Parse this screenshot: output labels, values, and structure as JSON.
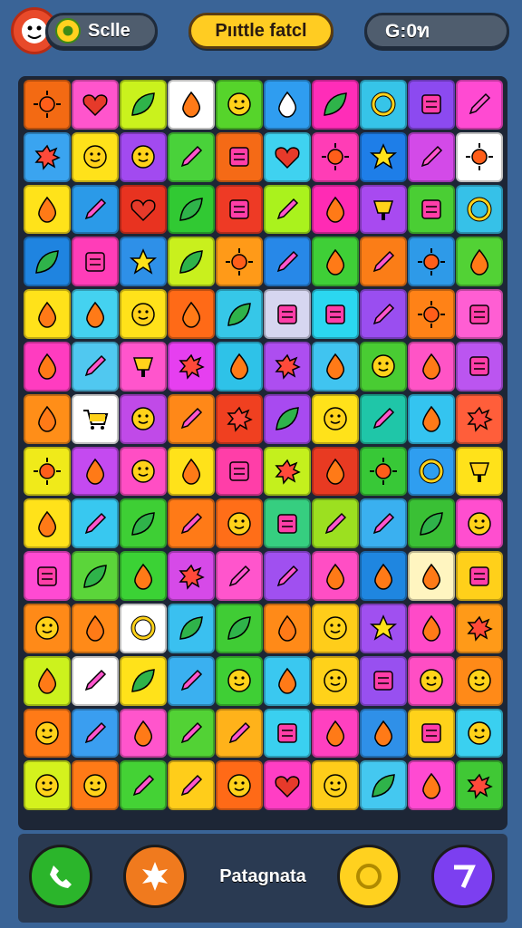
{
  "header": {
    "left_label": "Sclle",
    "title": "Pııttle fatcl",
    "right_value": "G:0ท"
  },
  "footer": {
    "label": "Patagnata",
    "buttons": [
      {
        "name": "phone-button",
        "icon": "phone-icon",
        "color": "#2bb52b"
      },
      {
        "name": "burst-button",
        "icon": "burst-icon",
        "color": "#f07a1e"
      },
      {
        "name": "coin-button",
        "icon": "coin-icon",
        "color": "#ffd11f"
      },
      {
        "name": "seven-button",
        "icon": "seven-icon",
        "color": "#7c3ff0"
      }
    ]
  },
  "board": {
    "rows": 14,
    "cols": 10,
    "tiles": [
      [
        "#f36a13:sun",
        "#ff55cc:heart",
        "#caf21d:leaf",
        "#ffffff:drop",
        "#56d42b:face",
        "#2f9df0:bell",
        "#ff2db8:leaf",
        "#36c4e8:ring",
        "#8c4af0:box",
        "#ff4ad2:pencil"
      ],
      [
        "#3aa4f0:splat",
        "#ffe21a:face",
        "#a24af0:face",
        "#49d23a:pencil",
        "#f56a16:box",
        "#3fd2f0:heart",
        "#ff3db6:sun",
        "#1e7ee8:star",
        "#d34ae8:pencil",
        "#ffffff:sun"
      ],
      [
        "#ffe31a:drop",
        "#2b9ae8:pencil",
        "#e83320:heart",
        "#31c933:leaf",
        "#ee3a25:box",
        "#aaf21d:pencil",
        "#ff2bb4:drop",
        "#a84af0:cup",
        "#4ace34:box",
        "#36c1e8:ring"
      ],
      [
        "#1f84e0:leaf",
        "#ff3db8:box",
        "#2e90e8:star",
        "#c9f01d:leaf",
        "#ff9a18:sun",
        "#2788e8:pencil",
        "#3fcf37:drop",
        "#fb7d17:pencil",
        "#2e9ae8:sun",
        "#52d235:drop"
      ],
      [
        "#ffe21a:drop",
        "#44d2f0:drop",
        "#ffe21a:face",
        "#ff6a17:drop",
        "#36c7e8:leaf",
        "#d6d6f0:box",
        "#2bd7f0:box",
        "#9a4ef0:pencil",
        "#ff8217:sun",
        "#ff5ed3:box"
      ],
      [
        "#ff3cc0:drop",
        "#50c8f0:pencil",
        "#ff55cc:cup",
        "#e63ff0:splat",
        "#2ec2e8:drop",
        "#ad4ef0:splat",
        "#40c4f0:drop",
        "#49cc33:face",
        "#ff54c6:drop",
        "#bb55f0:box"
      ],
      [
        "#ff8e18:drop",
        "#ffffff:cart",
        "#c04ae8:face",
        "#ff8818:pencil",
        "#f04020:splat",
        "#a84af0:leaf",
        "#ffe21a:face",
        "#1fc6a8:pencil",
        "#34c4f0:drop",
        "#ff5e3a:splat"
      ],
      [
        "#f0ea1a:sun",
        "#c44af0:drop",
        "#ff4ec4:face",
        "#ffe21a:drop",
        "#ff3ea8:box",
        "#c4f01d:splat",
        "#e83a22:drop",
        "#38c837:sun",
        "#2f9ef0:ring",
        "#ffe21a:cup"
      ],
      [
        "#ffe21a:drop",
        "#38c8f0:pencil",
        "#3ecf35:leaf",
        "#ff7a17:pencil",
        "#ff6e18:face",
        "#36ce80:box",
        "#9ce020:pencil",
        "#3ab0f0:pencil",
        "#3ac035:leaf",
        "#ff4ecf:face"
      ],
      [
        "#ff4ad2:box",
        "#5bd53a:leaf",
        "#3bd235:drop",
        "#d64ae8:splat",
        "#ff55cc:pencil",
        "#a050f0:pencil",
        "#ff4ec4:drop",
        "#1f86e0:drop",
        "#fff5c0:drop",
        "#ffd01a:box"
      ],
      [
        "#ff8a18:face",
        "#ff8a18:drop",
        "#ffffff:ring",
        "#3ac0f0:leaf",
        "#40cc35:leaf",
        "#ff8a18:drop",
        "#ffcd1a:face",
        "#a050f0:star",
        "#ff4ac8:drop",
        "#ff9a18:splat"
      ],
      [
        "#ccf21d:drop",
        "#ffffff:pencil",
        "#ffe21a:leaf",
        "#3ab0f0:pencil",
        "#3fcf35:face",
        "#3ac8f0:drop",
        "#ffd21a:face",
        "#9850f0:box",
        "#ff4ec4:face",
        "#ff8a18:face"
      ],
      [
        "#ff7a17:face",
        "#3a9ef0:pencil",
        "#ff55cc:drop",
        "#52d235:pencil",
        "#ffb21a:pencil",
        "#3ad0f0:box",
        "#ff40c0:drop",
        "#2f90e8:drop",
        "#ffd21a:box",
        "#3ad0f0:face"
      ],
      [
        "#d4f21d:face",
        "#ff7a17:face",
        "#44d235:pencil",
        "#ffcd1a:pencil",
        "#ff6a17:face",
        "#ff3ec4:heart",
        "#ffcd1a:face",
        "#44c8f0:leaf",
        "#ff4ad2:drop",
        "#40c835:splat"
      ]
    ]
  }
}
